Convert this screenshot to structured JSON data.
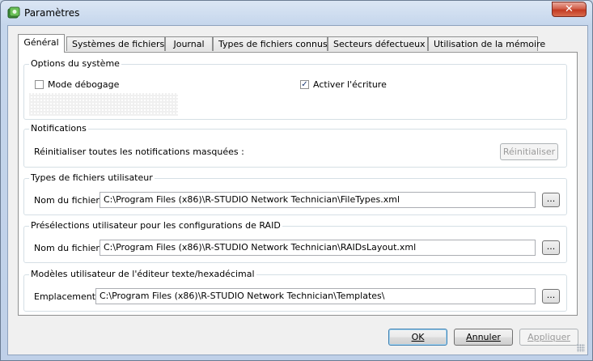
{
  "window": {
    "title": "Paramètres",
    "close_glyph": "✕"
  },
  "tabs": [
    {
      "label": "Général",
      "active": true
    },
    {
      "label": "Systèmes de fichiers",
      "active": false
    },
    {
      "label": "Journal",
      "active": false
    },
    {
      "label": "Types de fichiers connus",
      "active": false
    },
    {
      "label": "Secteurs défectueux",
      "active": false
    },
    {
      "label": "Utilisation de la mémoire",
      "active": false
    }
  ],
  "system_options": {
    "title": "Options du système",
    "debug_mode": {
      "label": "Mode débogage",
      "checked": false
    },
    "enable_write": {
      "label": "Activer l'écriture",
      "checked": true,
      "check_glyph": "✓"
    }
  },
  "notifications": {
    "title": "Notifications",
    "reset_label": "Réinitialiser toutes les notifications masquées :",
    "reset_button": "Réinitialiser"
  },
  "user_file_types": {
    "title": "Types de fichiers utilisateur",
    "field_label": "Nom du fichier :",
    "value": "C:\\Program Files (x86)\\R-STUDIO Network Technician\\FileTypes.xml",
    "browse": "..."
  },
  "raid_presets": {
    "title": "Présélections utilisateur pour les configurations de RAID",
    "field_label": "Nom du fichier :",
    "value": "C:\\Program Files (x86)\\R-STUDIO Network Technician\\RAIDsLayout.xml",
    "browse": "..."
  },
  "hex_templates": {
    "title": "Modèles utilisateur de l'éditeur texte/hexadécimal",
    "field_label": "Emplacement :",
    "value": "C:\\Program Files (x86)\\R-STUDIO Network Technician\\Templates\\",
    "browse": "..."
  },
  "footer": {
    "ok": "OK",
    "cancel": "Annuler",
    "apply": "Appliquer"
  },
  "colors": {
    "title_bar": "#c5d6ec",
    "close_button": "#c33a22",
    "panel_background": "#ffffff",
    "dialog_background": "#f0f0f0"
  }
}
